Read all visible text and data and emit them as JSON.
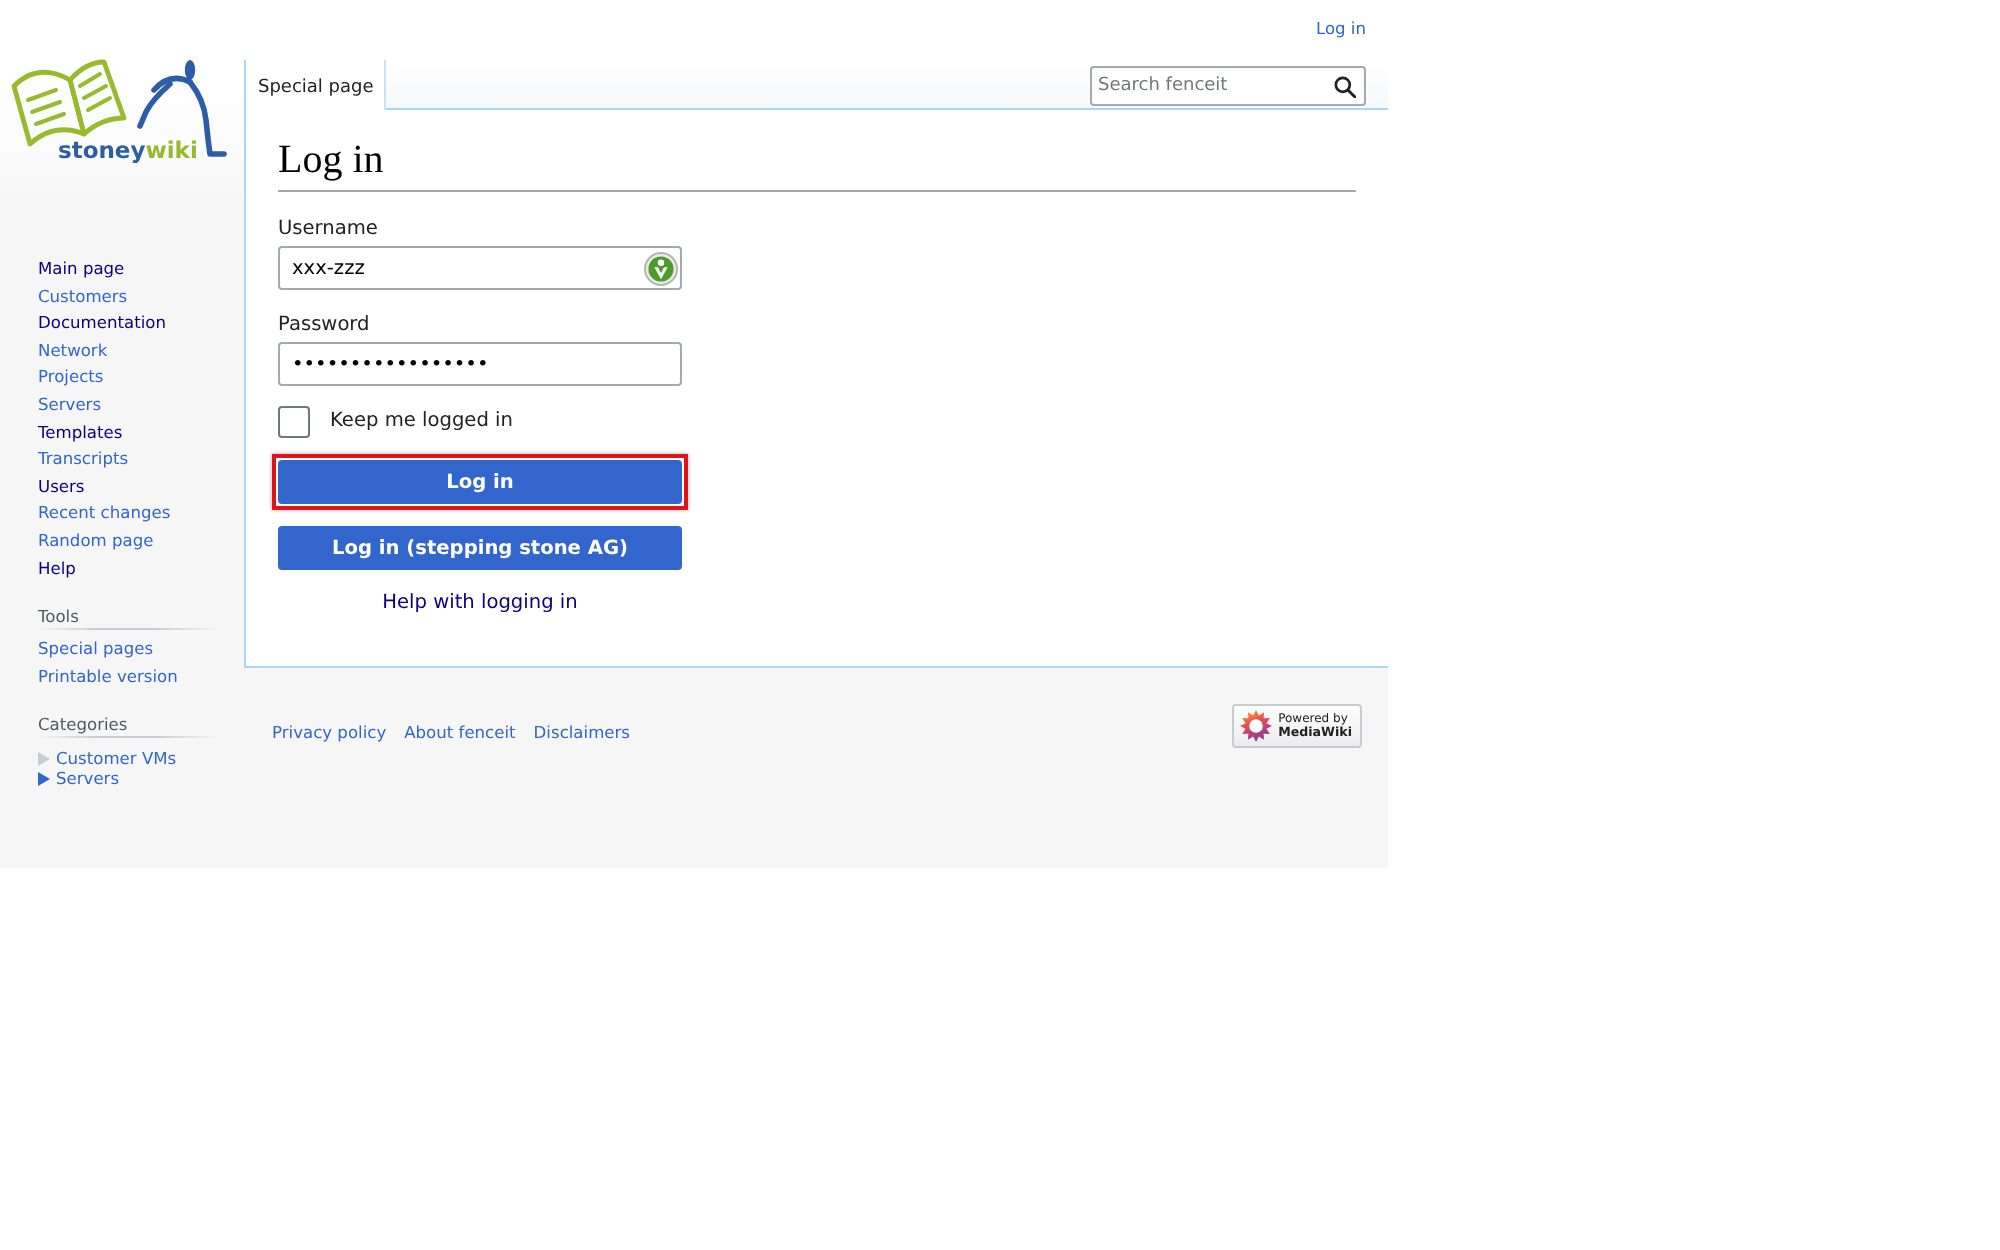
{
  "personal_tools": [
    {
      "label": "Log in"
    }
  ],
  "logo": {
    "parts": [
      {
        "text": "stoney",
        "color": "#2e5da8"
      },
      {
        "text": "wiki",
        "color": "#9aba2d"
      }
    ]
  },
  "sidebar": {
    "sections": [
      {
        "kind": "links",
        "items": [
          {
            "label": "Main page",
            "visited": true
          },
          {
            "label": "Customers",
            "visited": false
          },
          {
            "label": "Documentation",
            "visited": true
          },
          {
            "label": "Network",
            "visited": false
          },
          {
            "label": "Projects",
            "visited": false
          },
          {
            "label": "Servers",
            "visited": false
          },
          {
            "label": "Templates",
            "visited": true
          },
          {
            "label": "Transcripts",
            "visited": false
          },
          {
            "label": "Users",
            "visited": true
          },
          {
            "label": "Recent changes",
            "visited": false
          },
          {
            "label": "Random page",
            "visited": false
          },
          {
            "label": "Help",
            "visited": true
          }
        ]
      },
      {
        "kind": "links",
        "heading": "Tools",
        "items": [
          {
            "label": "Special pages",
            "visited": false
          },
          {
            "label": "Printable version",
            "visited": false
          }
        ]
      },
      {
        "kind": "tree",
        "heading": "Categories",
        "items": [
          {
            "label": "Customer VMs",
            "visited": false,
            "expandable": false
          },
          {
            "label": "Servers",
            "visited": false,
            "expandable": true
          }
        ]
      }
    ]
  },
  "tabs": [
    {
      "label": "Special page",
      "selected": true
    }
  ],
  "search": {
    "placeholder": "Search fenceit"
  },
  "content": {
    "title": "Log in",
    "fields": [
      {
        "label": "Username",
        "value": "xxx-zzz",
        "badge": true
      },
      {
        "label": "Password",
        "value": "•••••••••••••••••",
        "badge": false
      }
    ],
    "remember": {
      "label": "Keep me logged in",
      "checked": false
    },
    "buttons": [
      {
        "label": "Log in",
        "highlighted": true
      },
      {
        "label": "Log in (stepping stone AG)",
        "highlighted": false
      }
    ],
    "help_link": {
      "label": "Help with logging in",
      "visited": true
    }
  },
  "footer": {
    "links": [
      {
        "label": "Privacy policy"
      },
      {
        "label": "About fenceit"
      },
      {
        "label": "Disclaimers"
      }
    ],
    "powered_by": {
      "lines": [
        "Powered by",
        "MediaWiki"
      ]
    }
  }
}
